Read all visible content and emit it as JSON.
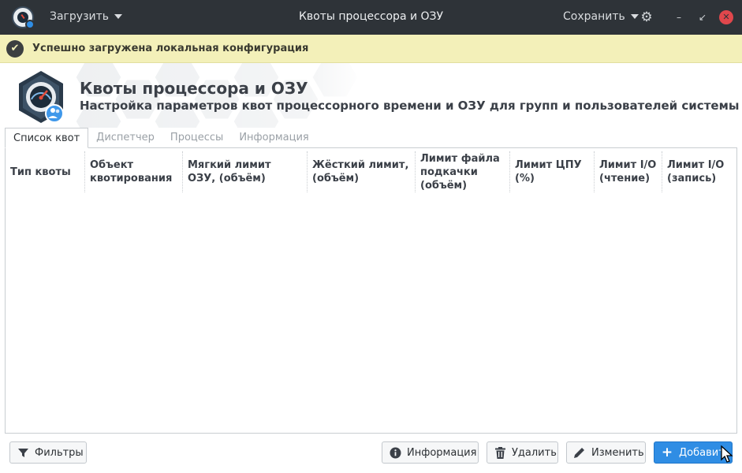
{
  "window": {
    "title": "Квоты процессора и ОЗУ",
    "load_menu": "Загрузить",
    "save_menu": "Сохранить",
    "minimize": "–",
    "maximize": "↙",
    "close": "✕"
  },
  "notice": {
    "message": "Успешно загружена локальная конфигурация"
  },
  "header": {
    "title": "Квоты процессора и ОЗУ",
    "subtitle": "Настройка параметров квот процессорного времени и ОЗУ для групп и пользователей системы"
  },
  "tabs": [
    {
      "label": "Список квот",
      "active": true
    },
    {
      "label": "Диспетчер",
      "active": false
    },
    {
      "label": "Процессы",
      "active": false
    },
    {
      "label": "Информация",
      "active": false
    }
  ],
  "table": {
    "columns": [
      "Тип квоты",
      "Объект квотирования",
      "Мягкий лимит ОЗУ, (объём)",
      "Жёсткий лимит, (объём)",
      "Лимит файла подкачки (объём)",
      "Лимит ЦПУ (%)",
      "Лимит I/O (чтение)",
      "Лимит I/O (запись)"
    ],
    "rows": []
  },
  "buttons": {
    "filters": "Фильтры",
    "info": "Информация",
    "delete": "Удалить",
    "edit": "Изменить",
    "add": "Добавить"
  },
  "icons": {
    "app": "cpu-ram-quota-app-icon",
    "filter": "funnel-icon",
    "info": "info-icon",
    "delete": "trash-icon",
    "edit": "pencil-icon",
    "add": "plus-icon",
    "settings": "gear-icon",
    "notice": "check-circle-icon"
  },
  "colors": {
    "titlebar": "#2e3338",
    "notice_bg": "#f3f0b9",
    "accent": "#2f8de4",
    "close": "#e0474c"
  }
}
